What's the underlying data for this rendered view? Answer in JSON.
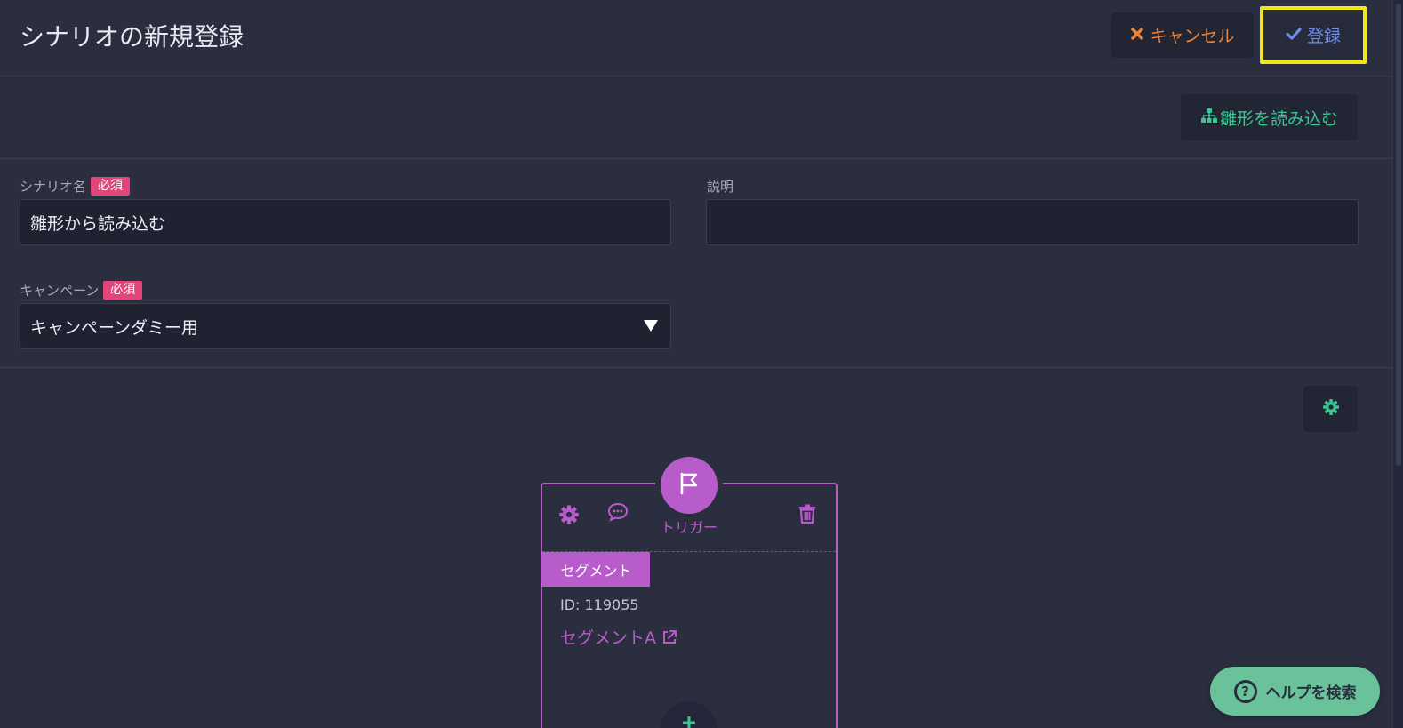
{
  "header": {
    "title": "シナリオの新規登録",
    "cancel_label": "キャンセル",
    "submit_label": "登録"
  },
  "toolbar": {
    "load_template_label": "雛形を読み込む"
  },
  "form": {
    "name": {
      "label": "シナリオ名",
      "required_badge": "必須",
      "value": "雛形から読み込む"
    },
    "description": {
      "label": "説明",
      "value": ""
    },
    "campaign": {
      "label": "キャンペーン",
      "required_badge": "必須",
      "selected": "キャンペーンダミー用"
    }
  },
  "node": {
    "title": "トリガー",
    "segment_tag": "セグメント",
    "segment_id": "ID: 119055",
    "segment_name": "セグメントA"
  },
  "help": {
    "label": "ヘルプを検索"
  },
  "colors": {
    "background": "#2b2e3f",
    "accent_green": "#3cc493",
    "accent_purple": "#b85ccb",
    "cancel_orange": "#e9843c",
    "submit_blue": "#6d8de6",
    "required_pink": "#e0457b",
    "focus_yellow": "#f1e51c"
  },
  "icons": {
    "cancel": "x-icon",
    "submit": "check-icon",
    "load_template": "sitemap-icon",
    "canvas_settings": "gear-icon",
    "node_settings": "gear-icon",
    "node_comment": "comment-icon",
    "node_type": "flag-icon",
    "node_delete": "trash-icon",
    "external_link": "external-link-icon",
    "help": "question-circle-icon"
  }
}
